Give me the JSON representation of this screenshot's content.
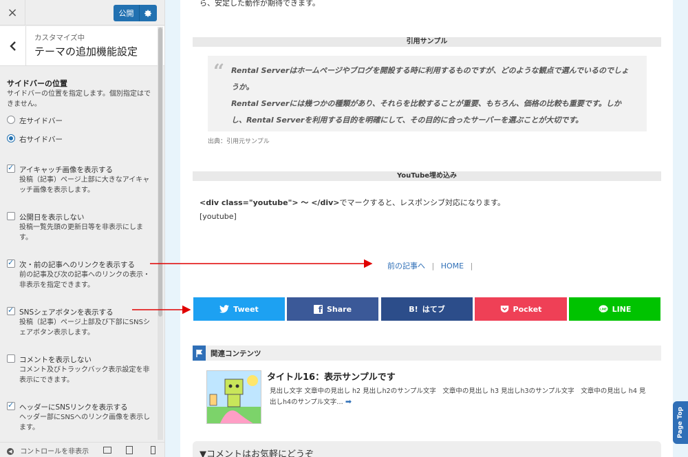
{
  "topbar": {
    "close_icon": "×",
    "publish_label": "公開"
  },
  "header": {
    "crumb": "カスタマイズ中",
    "title": "テーマの追加機能設定"
  },
  "sidebar_position": {
    "title": "サイドバーの位置",
    "desc": "サイドバーの位置を指定します。個別指定はできません。",
    "options": [
      {
        "label": "左サイドバー",
        "selected": false
      },
      {
        "label": "右サイドバー",
        "selected": true
      }
    ]
  },
  "checkboxes": [
    {
      "label": "アイキャッチ画像を表示する",
      "desc": "投稿（記事）ページ上部に大きなアイキャッチ画像を表示します。",
      "checked": true
    },
    {
      "label": "公開日を表示しない",
      "desc": "投稿一覧先頭の更新日等を非表示にします。",
      "checked": false
    },
    {
      "label": "次・前の記事へのリンクを表示する",
      "desc": "前の記事及び次の記事へのリンクの表示・非表示を指定できます。",
      "checked": true
    },
    {
      "label": "SNSシェアボタンを表示する",
      "desc": "投稿（記事）ページ上部及び下部にSNSシェアボタン表示します。",
      "checked": true
    },
    {
      "label": "コメントを表示しない",
      "desc": "コメント及びトラックバック表示設定を非表示にできます。",
      "checked": false
    },
    {
      "label": "ヘッダーにSNSリンクを表示する",
      "desc": "ヘッダー部にSNSへのリンク画像を表示します。",
      "checked": true
    }
  ],
  "footer": {
    "hide_controls": "コントロールを非表示"
  },
  "preview": {
    "top_text": "ら、安定した動作が期待できます。",
    "quote_bar": "引用サンプル",
    "quote_lines": [
      "Rental Serverはホームページやブログを開設する時に利用するものですが、どのような観点で選んでいるのでしょ",
      "うか。",
      "Rental Serverには幾つかの種類があり、それらを比較することが重要、もちろん、価格の比較も重要です。しか",
      "し、Rental Serverを利用する目的を明確にして、その目的に合ったサーバーを選ぶことが大切です。"
    ],
    "quote_source": "出典：引用元サンプル",
    "youtube_bar": "YouTube埋め込み",
    "youtube_code": "<div class=\"youtube\"> 〜 </div>",
    "youtube_text": "でマークすると、レスポンシブ対応になります。",
    "youtube_tag": "[youtube]",
    "nav_prev": "前の記事へ",
    "nav_sep": "|",
    "nav_home": "HOME",
    "share_buttons": [
      {
        "label": "Tweet",
        "icon": "twitter-icon",
        "color": "#1da1f2"
      },
      {
        "label": "Share",
        "icon": "facebook-icon",
        "color": "#3b5998"
      },
      {
        "label": "はてブ",
        "icon": "hatena-icon",
        "color": "#2c4d8a"
      },
      {
        "label": "Pocket",
        "icon": "pocket-icon",
        "color": "#ef4056"
      },
      {
        "label": "LINE",
        "icon": "line-icon",
        "color": "#00c300"
      }
    ],
    "hatena_prefix": "B!",
    "related_title": "関連コンテンツ",
    "related_post_title": "タイトル16：表示サンプルです",
    "related_post_excerpt": "見出し文字 文章中の見出し h2 見出しh2のサンプル文字　文章中の見出し h3 見出しh3のサンプル文字　文章中の見出し h4 見出しh4のサンプル文字…",
    "comment_title": "▼コメントはお気軽にどうぞ",
    "page_top": "Page Top"
  },
  "colors": {
    "accent": "#2271b1",
    "arrow": "#e00000",
    "link": "#2f6fb7"
  }
}
